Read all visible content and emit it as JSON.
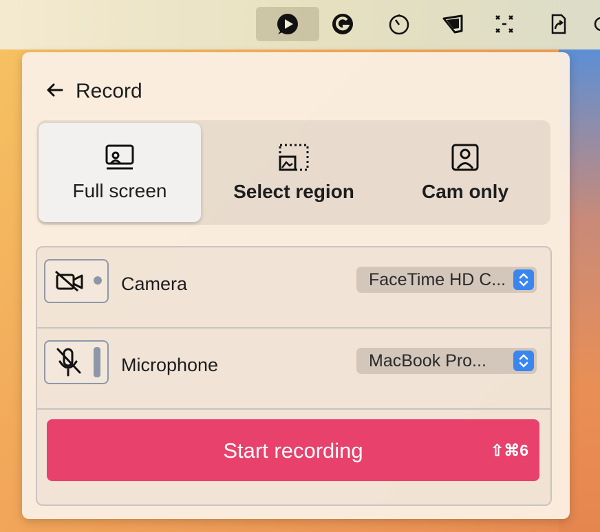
{
  "menubar": {
    "icons": [
      "screen-recorder-app-icon",
      "grammarly-icon",
      "timer-icon",
      "tag-icon",
      "expand-arrows-icon",
      "share-document-icon"
    ]
  },
  "header": {
    "title": "Record",
    "back_icon": "arrow-left-icon"
  },
  "modes": [
    {
      "label": "Full screen",
      "icon": "monitor-user-icon",
      "selected": true
    },
    {
      "label": "Select region",
      "icon": "dashed-region-icon",
      "selected": false
    },
    {
      "label": "Cam only",
      "icon": "user-square-icon",
      "selected": false
    }
  ],
  "camera": {
    "label": "Camera",
    "device": "FaceTime HD C...",
    "icon": "video-off-icon"
  },
  "microphone": {
    "label": "Microphone",
    "device": "MacBook Pro...",
    "icon": "mic-off-icon"
  },
  "start": {
    "label": "Start recording",
    "shortcut": "⇧⌘6"
  },
  "colors": {
    "accent": "#e8416b",
    "select_stepper": "#3a86f0"
  }
}
